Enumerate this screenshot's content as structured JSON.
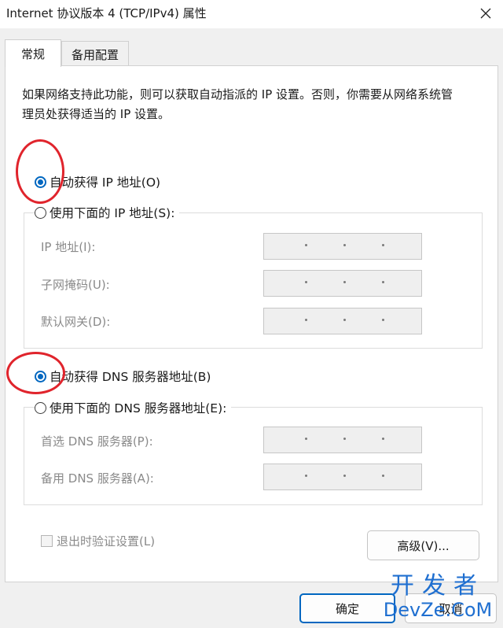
{
  "window": {
    "title": "Internet 协议版本 4 (TCP/IPv4) 属性",
    "close_icon": "close-icon"
  },
  "tabs": [
    {
      "label": "常规"
    },
    {
      "label": "备用配置"
    }
  ],
  "description": "如果网络支持此功能，则可以获取自动指派的 IP 设置。否则，你需要从网络系统管理员处获得适当的 IP 设置。",
  "ip_section": {
    "auto_label": "自动获得 IP 地址(O)",
    "manual_label": "使用下面的 IP 地址(S):",
    "selected": "auto",
    "fields": [
      {
        "label": "IP 地址(I):",
        "value": ""
      },
      {
        "label": "子网掩码(U):",
        "value": ""
      },
      {
        "label": "默认网关(D):",
        "value": ""
      }
    ]
  },
  "dns_section": {
    "auto_label": "自动获得 DNS 服务器地址(B)",
    "manual_label": "使用下面的 DNS 服务器地址(E):",
    "selected": "auto",
    "fields": [
      {
        "label": "首选 DNS 服务器(P):",
        "value": ""
      },
      {
        "label": "备用 DNS 服务器(A):",
        "value": ""
      }
    ]
  },
  "validate_checkbox": {
    "label": "退出时验证设置(L)",
    "checked": false
  },
  "buttons": {
    "advanced": "高级(V)...",
    "ok": "确定",
    "cancel": "取消"
  },
  "watermark": {
    "top": "开发者",
    "bottom": "DevZe.CoM"
  },
  "colors": {
    "accent": "#0067c0",
    "annotation": "#e0242c",
    "watermark": "#1f6fd0"
  }
}
